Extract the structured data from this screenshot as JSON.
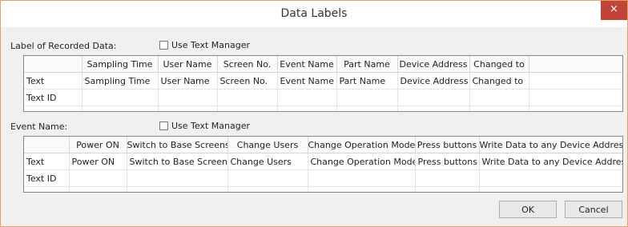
{
  "window": {
    "title": "Data Labels",
    "close_label": "×"
  },
  "recorded": {
    "label": "Label of Recorded Data:",
    "use_text_manager": "Use Text Manager",
    "columns": [
      "",
      "Sampling Time",
      "User Name",
      "Screen No.",
      "Event Name",
      "Part Name",
      "Device Address",
      "Changed to",
      ""
    ],
    "rows": [
      [
        "Text",
        "Sampling Time",
        "User Name",
        "Screen No.",
        "Event Name",
        "Part Name",
        "Device Address",
        "Changed to",
        ""
      ],
      [
        "Text ID",
        "",
        "",
        "",
        "",
        "",
        "",
        "",
        ""
      ],
      [
        "",
        "",
        "",
        "",
        "",
        "",
        "",
        "",
        ""
      ]
    ]
  },
  "event": {
    "label": "Event Name:",
    "use_text_manager": "Use Text Manager",
    "columns": [
      "",
      "Power ON",
      "Switch to Base Screens",
      "Change Users",
      "Change Operation Modes",
      "Press buttons",
      "Write Data to any Device Addresses"
    ],
    "rows": [
      [
        "Text",
        "Power ON",
        "Switch to Base Screens",
        "Change Users",
        "Change Operation Modes",
        "Press buttons",
        "Write Data to any Device Addresses"
      ],
      [
        "Text ID",
        "",
        "",
        "",
        "",
        "",
        ""
      ],
      [
        "",
        "",
        "",
        "",
        "",
        "",
        ""
      ]
    ]
  },
  "buttons": {
    "ok": "OK",
    "cancel": "Cancel"
  }
}
